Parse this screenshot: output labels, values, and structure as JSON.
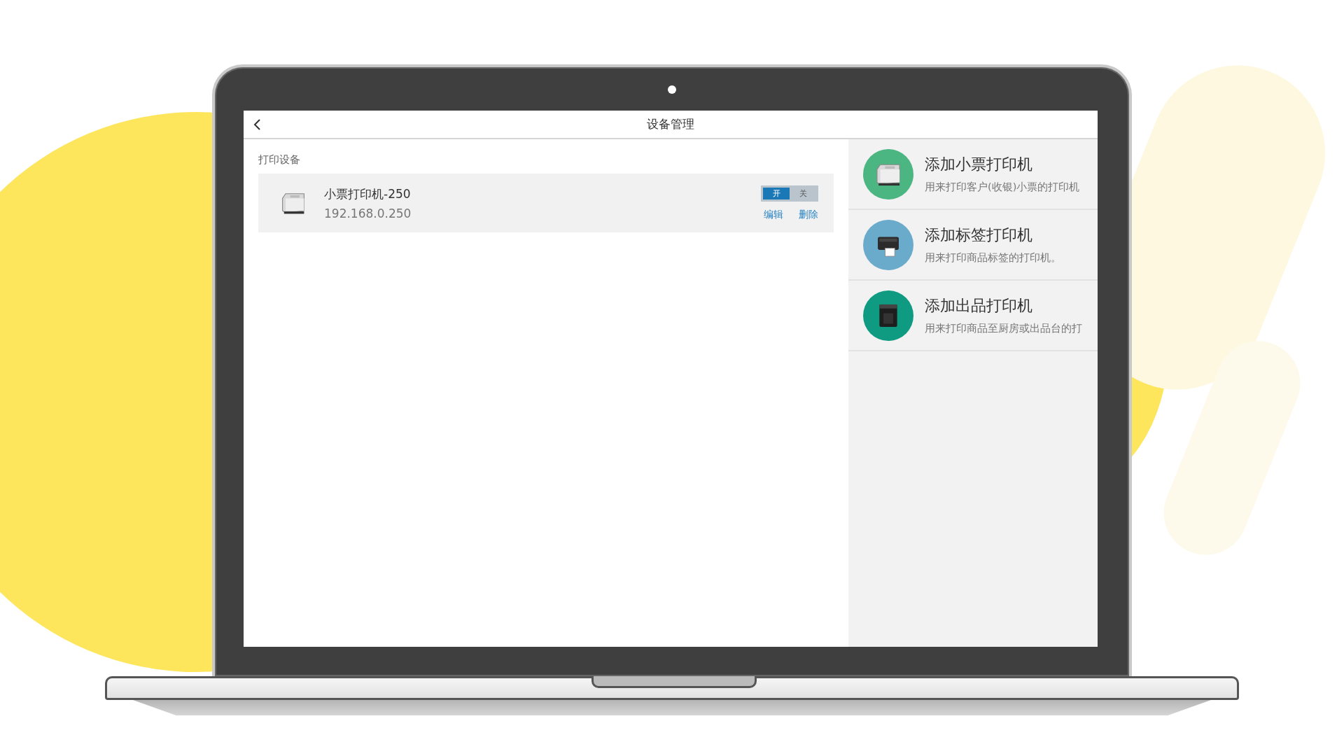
{
  "window": {
    "title": "设备管理"
  },
  "devices": {
    "heading": "打印设备",
    "items": [
      {
        "name": "小票打印机-250",
        "address": "192.168.0.250",
        "toggle": [
          {
            "label": "开",
            "selected": true
          },
          {
            "label": "关",
            "selected": false
          }
        ],
        "actions": [
          "编辑",
          "删除"
        ]
      }
    ]
  },
  "add_options": [
    {
      "kind": "receipt",
      "color": "#4cb683",
      "title": "添加小票打印机",
      "description": "用来打印客户(收银)小票的打印机"
    },
    {
      "kind": "label",
      "color": "#6aaacb",
      "title": "添加标签打印机",
      "description": "用来打印商品标签的打印机。"
    },
    {
      "kind": "kitchen",
      "color": "#0f9a82",
      "title": "添加出品打印机",
      "description": "用来打印商品至厨房或出品台的打"
    }
  ]
}
